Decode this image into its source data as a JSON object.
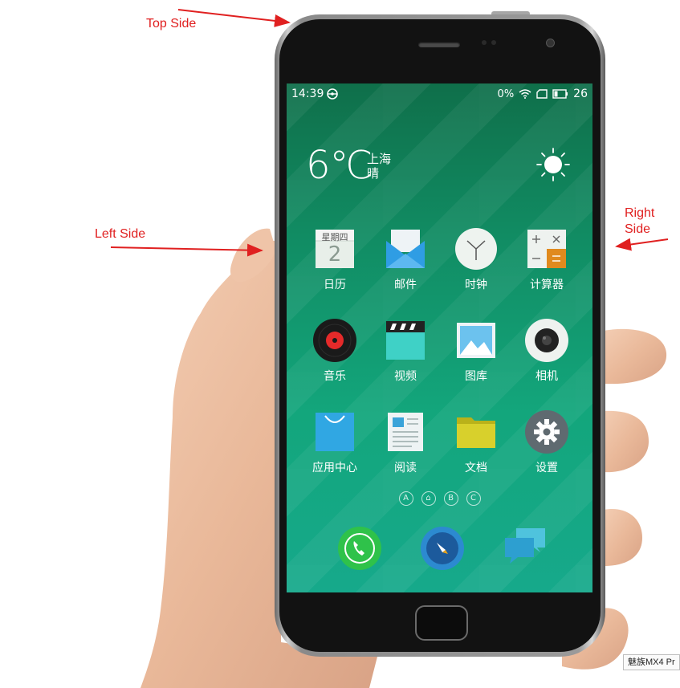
{
  "annotations": {
    "top": "Top Side",
    "left": "Left Side",
    "right_line1": "Right",
    "right_line2": "Side",
    "arrow_color": "#e02020"
  },
  "status_bar": {
    "time": "14:39",
    "battery_percent_text": "0%",
    "battery_level": "26"
  },
  "weather": {
    "temperature": "6℃",
    "city": "上海",
    "condition": "晴",
    "icon": "sun-icon"
  },
  "apps": [
    {
      "label": "日历",
      "icon": "calendar-icon",
      "weekday": "星期四",
      "day": "2"
    },
    {
      "label": "邮件",
      "icon": "mail-icon"
    },
    {
      "label": "时钟",
      "icon": "clock-icon"
    },
    {
      "label": "计算器",
      "icon": "calculator-icon"
    },
    {
      "label": "音乐",
      "icon": "music-icon"
    },
    {
      "label": "视频",
      "icon": "video-icon"
    },
    {
      "label": "图库",
      "icon": "gallery-icon"
    },
    {
      "label": "相机",
      "icon": "camera-icon"
    },
    {
      "label": "应用中心",
      "icon": "app-center-icon"
    },
    {
      "label": "阅读",
      "icon": "reader-icon"
    },
    {
      "label": "文档",
      "icon": "folder-icon"
    },
    {
      "label": "设置",
      "icon": "settings-icon"
    }
  ],
  "pager": [
    "A",
    "⌂",
    "B",
    "C"
  ],
  "dock": [
    {
      "icon": "phone-icon"
    },
    {
      "icon": "browser-compass-icon"
    },
    {
      "icon": "messages-icon"
    }
  ],
  "watermark": {
    "caption": "魅族MX4 Pr"
  },
  "colors": {
    "screen_top": "#0f6f4a",
    "screen_bottom": "#16a98b",
    "phone_frame": "#9a9a9a"
  }
}
